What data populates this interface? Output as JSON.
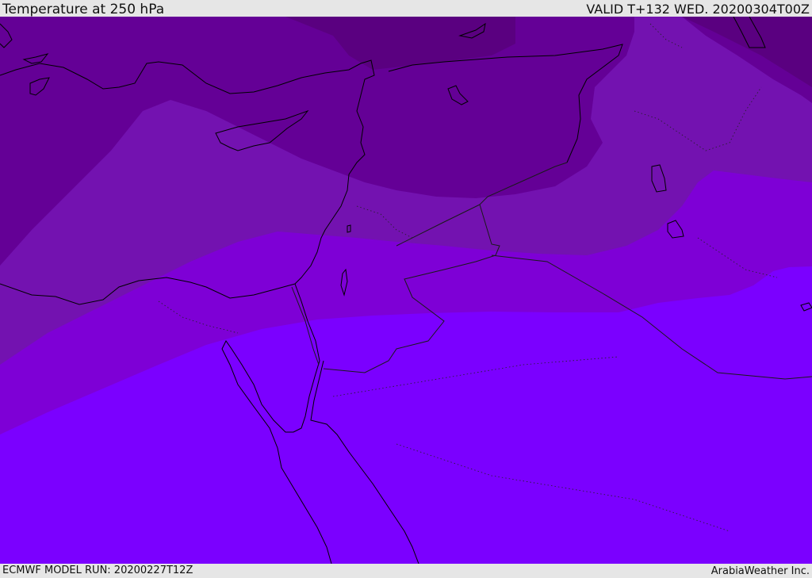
{
  "header": {
    "title": "Temperature at 250 hPa",
    "valid_time": "VALID T+132 WED. 20200304T00Z"
  },
  "footer": {
    "model_run": "ECMWF MODEL RUN: 20200227T12Z",
    "credit": "ArabiaWeather Inc."
  },
  "map": {
    "colors": {
      "band_darkest": "#5a0080",
      "band_dark": "#640096",
      "band_mid": "#7312b0",
      "band_light": "#7e00d6",
      "band_lightest": "#7b00ff",
      "coastline": "#000000",
      "border": "#1a1a1a"
    }
  }
}
